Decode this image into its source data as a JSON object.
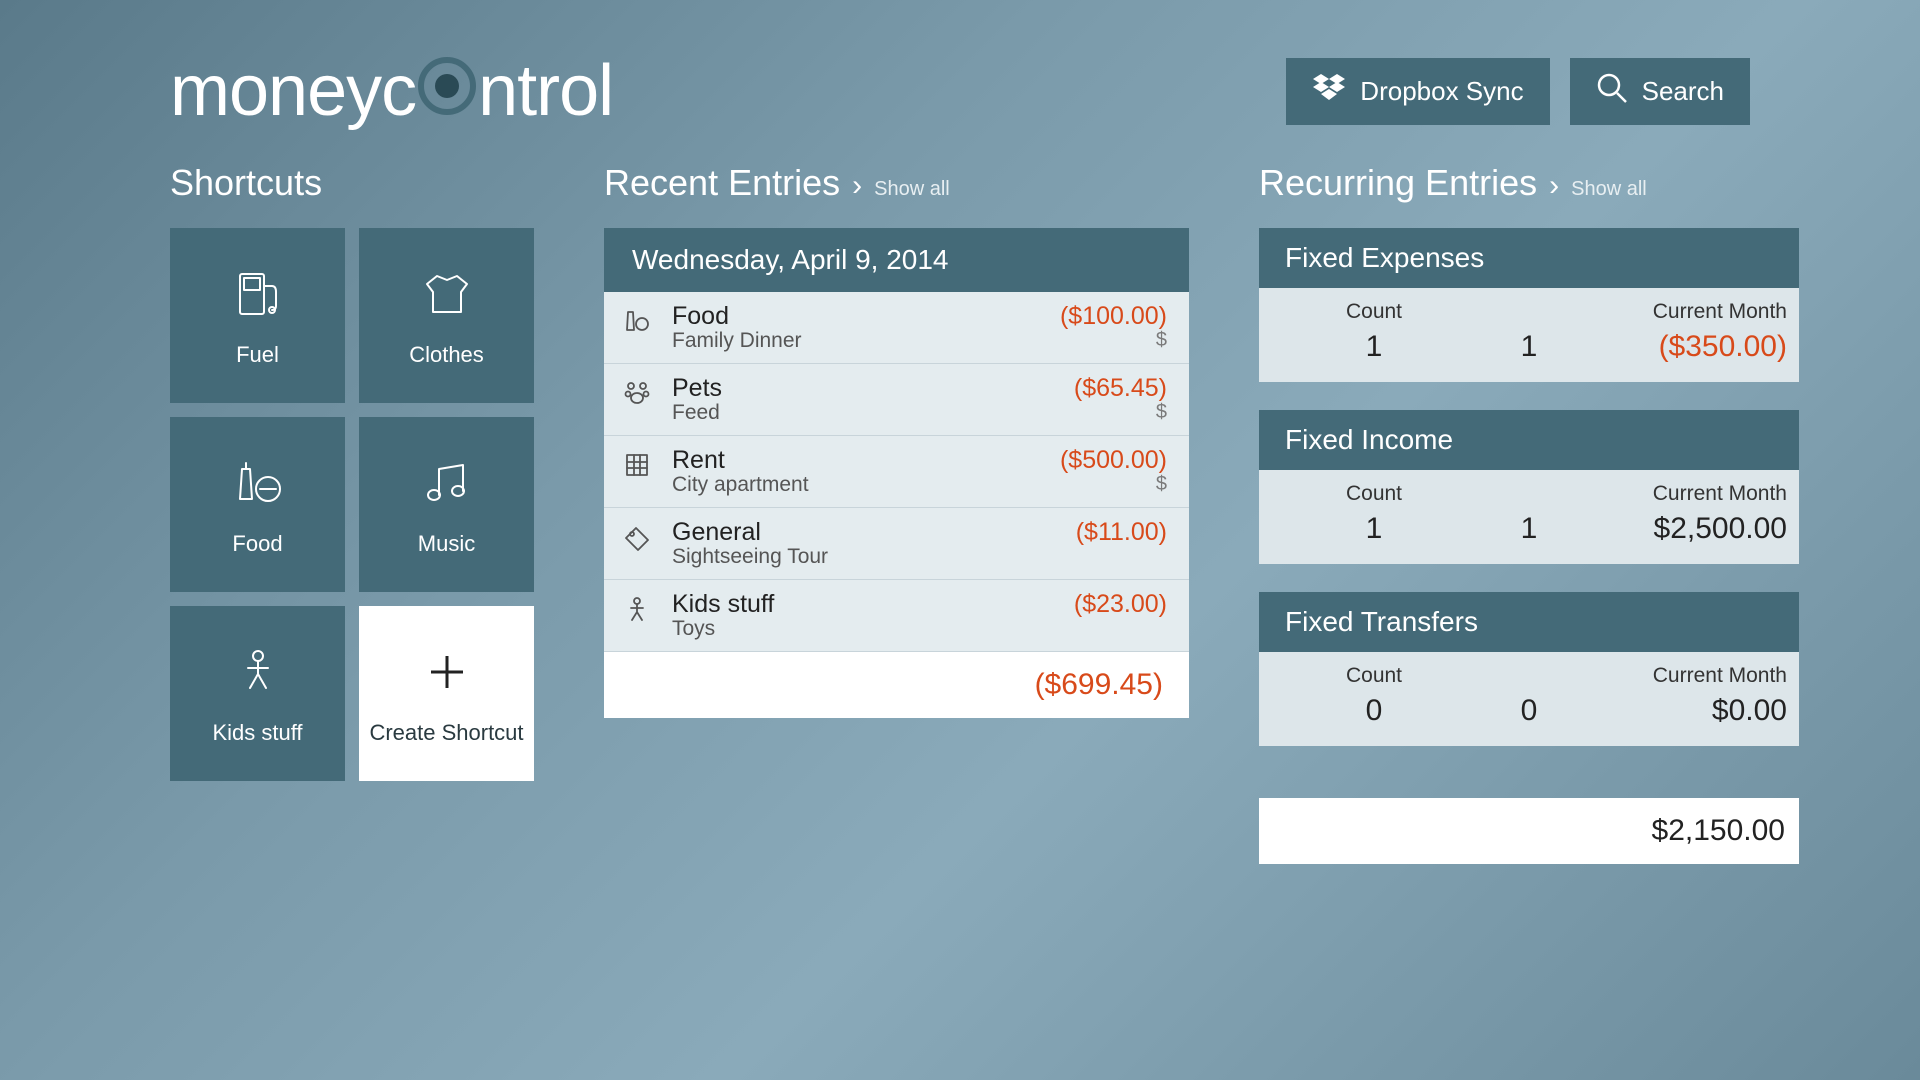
{
  "header": {
    "logo_money": "money",
    "logo_c": "c",
    "logo_ntrol": "ntrol",
    "dropbox_label": "Dropbox Sync",
    "search_label": "Search"
  },
  "shortcuts": {
    "title": "Shortcuts",
    "tiles": [
      {
        "label": "Fuel",
        "icon": "fuel"
      },
      {
        "label": "Clothes",
        "icon": "clothes"
      },
      {
        "label": "Food",
        "icon": "food"
      },
      {
        "label": "Music",
        "icon": "music"
      },
      {
        "label": "Kids stuff",
        "icon": "kids"
      }
    ],
    "create_label": "Create Shortcut"
  },
  "recent": {
    "title": "Recent Entries",
    "show_all": "Show all",
    "date": "Wednesday, April 9, 2014",
    "entries": [
      {
        "icon": "food",
        "category": "Food",
        "sub": "Family Dinner",
        "amount": "($100.00)",
        "cur": "$"
      },
      {
        "icon": "pets",
        "category": "Pets",
        "sub": "Feed",
        "amount": "($65.45)",
        "cur": "$"
      },
      {
        "icon": "rent",
        "category": "Rent",
        "sub": "City apartment",
        "amount": "($500.00)",
        "cur": "$"
      },
      {
        "icon": "general",
        "category": "General",
        "sub": "Sightseeing Tour",
        "amount": "($11.00)",
        "cur": ""
      },
      {
        "icon": "kids",
        "category": "Kids stuff",
        "sub": "Toys",
        "amount": "($23.00)",
        "cur": ""
      }
    ],
    "total": "($699.45)"
  },
  "recurring": {
    "title": "Recurring Entries",
    "show_all": "Show all",
    "col_count": "Count",
    "col_month": "Current Month",
    "blocks": [
      {
        "title": "Fixed Expenses",
        "count": "1",
        "mid": "1",
        "month": "($350.00)",
        "neg": true
      },
      {
        "title": "Fixed Income",
        "count": "1",
        "mid": "1",
        "month": "$2,500.00",
        "neg": false
      },
      {
        "title": "Fixed Transfers",
        "count": "0",
        "mid": "0",
        "month": "$0.00",
        "neg": false
      }
    ],
    "total": "$2,150.00"
  }
}
